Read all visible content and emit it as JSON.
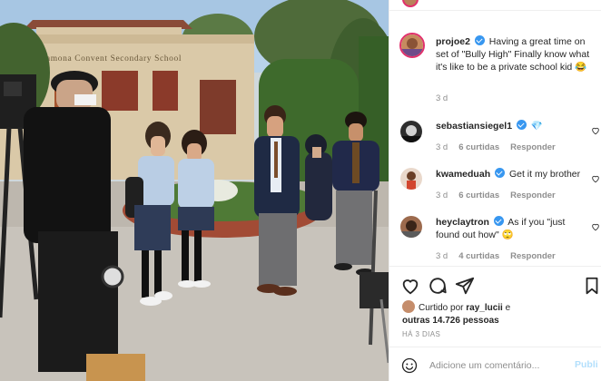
{
  "photo": {
    "school_sign": "Ramona Convent Secondary School",
    "alt": "Cena de set de filmagem em frente a uma escola"
  },
  "caption": {
    "username": "projoe2",
    "text": "Having a great time on set of \"Bully High\" Finally know what it's like to be a private school kid 😂",
    "time": "3 d"
  },
  "comments": [
    {
      "username": "sebastiansiegel1",
      "text": "💎",
      "time": "3 d",
      "likes": "6 curtidas",
      "reply": "Responder"
    },
    {
      "username": "kwameduah",
      "text": "Get it my brother",
      "time": "3 d",
      "likes": "6 curtidas",
      "reply": "Responder"
    },
    {
      "username": "heyclaytron",
      "text": "As if you \"just found out how\" 🙄",
      "time": "3 d",
      "likes": "4 curtidas",
      "reply": "Responder"
    }
  ],
  "likes": {
    "prefix": "Curtido por",
    "user": "ray_lucii",
    "conj": "e",
    "others": "outras 14.726 pessoas"
  },
  "post_age": "HÁ 3 DIAS",
  "add_comment": {
    "placeholder": "Adicione um comentário...",
    "publish": "Publi"
  },
  "colors": {
    "verified": "#3897f0",
    "muted": "#8e8e8e",
    "publish_disabled": "#b2dffc"
  },
  "icons": [
    "heart-icon",
    "comment-icon",
    "share-icon",
    "bookmark-icon",
    "emoji-icon",
    "verified-badge-icon"
  ]
}
